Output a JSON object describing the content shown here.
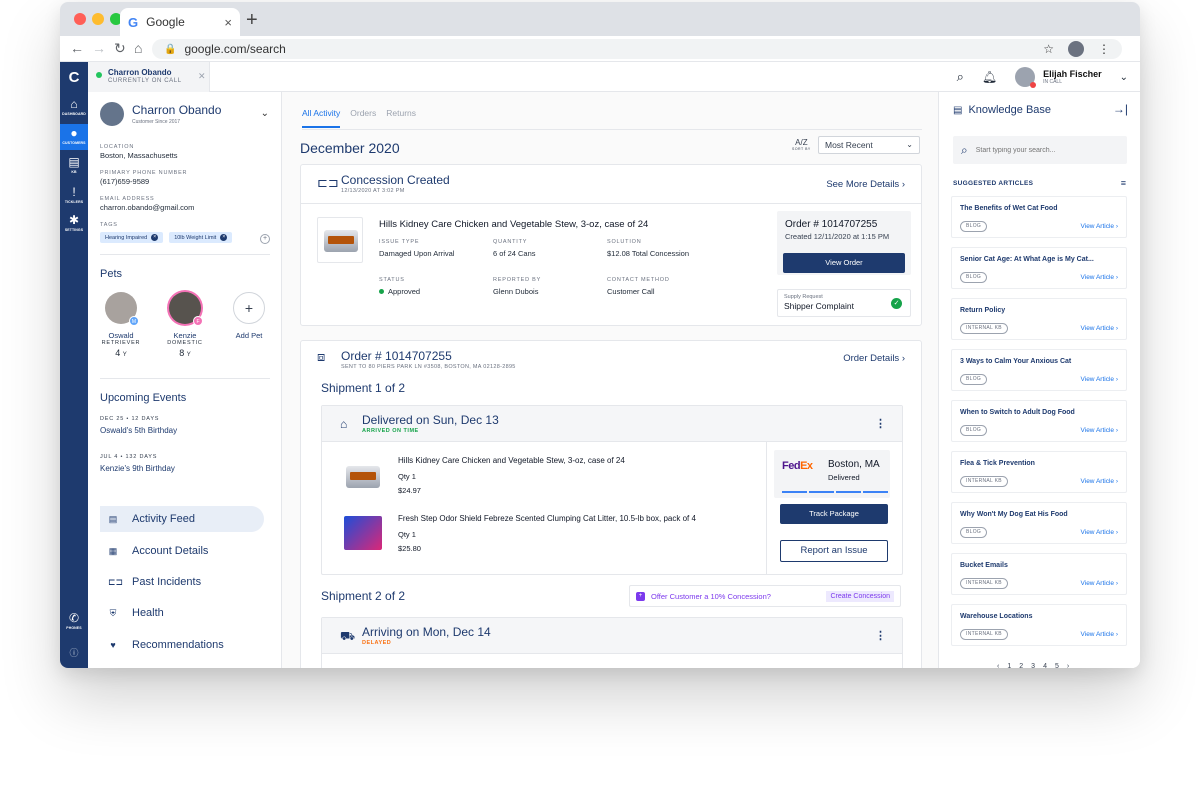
{
  "browser": {
    "tab_title": "Google",
    "tab_close": "×",
    "new_tab": "+",
    "url": "google.com/search"
  },
  "rail": {
    "logo": "C",
    "items": [
      {
        "label": "DASHBOARD",
        "icon": "home-icon"
      },
      {
        "label": "CUSTOMERS",
        "icon": "user-icon"
      },
      {
        "label": "KB",
        "icon": "book-icon"
      },
      {
        "label": "TICKLERS",
        "icon": "alert-icon"
      },
      {
        "label": "SETTINGS",
        "icon": "gear-icon"
      },
      {
        "label": "PHONES",
        "icon": "phone-icon"
      }
    ]
  },
  "topbar": {
    "call_name": "Charron Obando",
    "call_status": "CURRENTLY ON CALL",
    "agent_name": "Elijah Fischer",
    "agent_status": "IN CALL"
  },
  "customer": {
    "name": "Charron Obando",
    "since": "Customer Since 2017",
    "location_label": "LOCATION",
    "location": "Boston, Massachusetts",
    "phone_label": "PRIMARY PHONE NUMBER",
    "phone": "(617)659-9589",
    "email_label": "EMAIL ADDRESS",
    "email": "charron.obando@gmail.com",
    "tags_label": "TAGS",
    "tags": [
      "Hearing Impaired",
      "10lb Weight Limit"
    ]
  },
  "pets": {
    "title": "Pets",
    "items": [
      {
        "name": "Oswald",
        "breed": "RETRIEVER",
        "age": "4",
        "age_unit": "Y",
        "badge": "M"
      },
      {
        "name": "Kenzie",
        "breed": "DOMESTIC",
        "age": "8",
        "age_unit": "Y",
        "badge": "F"
      }
    ],
    "add_label": "Add Pet",
    "add_symbol": "+"
  },
  "events": {
    "title": "Upcoming Events",
    "items": [
      {
        "date": "DEC 25 • 12 DAYS",
        "title": "Oswald's 5th Birthday"
      },
      {
        "date": "JUL 4 • 132 DAYS",
        "title": "Kenzie's 9th Birthday"
      }
    ]
  },
  "nav": {
    "items": [
      "Activity Feed",
      "Account Details",
      "Past Incidents",
      "Health",
      "Recommendations"
    ]
  },
  "feed": {
    "tabs": [
      "All Activity",
      "Orders",
      "Returns"
    ],
    "month": "December 2020",
    "sort_label": "SORT BY",
    "sort_glyph": "A/Z",
    "sort_value": "Most Recent",
    "concession": {
      "title": "Concession Created",
      "date": "12/13/2020 AT 3:02 PM",
      "link": "See More Details",
      "product": "Hills Kidney Care Chicken and Vegetable Stew, 3-oz, case of 24",
      "issue_type_label": "ISSUE TYPE",
      "issue_type": "Damaged Upon Arrival",
      "quantity_label": "QUANTITY",
      "quantity": "6 of 24 Cans",
      "solution_label": "SOLUTION",
      "solution": "$12.08 Total Concession",
      "status_label": "STATUS",
      "status": "Approved",
      "reported_label": "REPORTED BY",
      "reported": "Glenn Dubois",
      "contact_label": "CONTACT METHOD",
      "contact": "Customer Call",
      "order_number": "Order # 1014707255",
      "order_created": "Created 12/11/2020 at 1:15 PM",
      "view_order": "View Order",
      "supply_label": "Supply Request",
      "supply_value": "Shipper Complaint"
    },
    "order": {
      "title": "Order # 1014707255",
      "sent_to": "SENT TO 80 PIERS PARK LN #3508, BOSTON, MA 02128-2895",
      "link": "Order Details",
      "shipment1_title": "Shipment 1 of 2",
      "delivered_title": "Delivered on Sun, Dec 13",
      "delivered_status": "ARRIVED ON TIME",
      "items": [
        {
          "name": "Hills Kidney Care Chicken and Vegetable Stew, 3-oz, case of 24",
          "qty": "Qty 1",
          "price": "$24.97"
        },
        {
          "name": "Fresh Step Odor Shield Febreze Scented Clumping Cat Litter, 10.5-lb box, pack of 4",
          "qty": "Qty 1",
          "price": "$25.80"
        }
      ],
      "carrier_fe": "Fed",
      "carrier_ex": "Ex",
      "carrier_city": "Boston, MA",
      "carrier_status": "Delivered",
      "track_label": "Track Package",
      "report_label": "Report an Issue",
      "shipment2_title": "Shipment 2 of 2",
      "offer_text": "Offer Customer a 10% Concession?",
      "offer_button": "Create Concession",
      "arriving_title": "Arriving on Mon, Dec 14",
      "arriving_status": "DELAYED"
    }
  },
  "kb": {
    "title": "Knowledge Base",
    "search_placeholder": "Start typing your search...",
    "suggested_label": "SUGGESTED ARTICLES",
    "view_label": "View Article",
    "articles": [
      {
        "title": "The Benefits of Wet Cat Food",
        "type": "BLOG"
      },
      {
        "title": "Senior Cat Age: At What Age is My Cat...",
        "type": "BLOG"
      },
      {
        "title": "Return Policy",
        "type": "INTERNAL KB"
      },
      {
        "title": "3 Ways to Calm Your Anxious Cat",
        "type": "BLOG"
      },
      {
        "title": "When to Switch to Adult Dog Food",
        "type": "BLOG"
      },
      {
        "title": "Flea & Tick Prevention",
        "type": "INTERNAL KB"
      },
      {
        "title": "Why Won't My Dog Eat His Food",
        "type": "BLOG"
      },
      {
        "title": "Bucket Emails",
        "type": "INTERNAL KB"
      },
      {
        "title": "Warehouse Locations",
        "type": "INTERNAL KB"
      }
    ],
    "pages": [
      "1",
      "2",
      "3",
      "4",
      "5"
    ]
  },
  "colors": {
    "navy": "#1e3a6e",
    "accent_blue": "#1a73e8",
    "success_green": "#16a34a",
    "delayed_orange": "#f97316",
    "offer_purple": "#7c3aed"
  }
}
